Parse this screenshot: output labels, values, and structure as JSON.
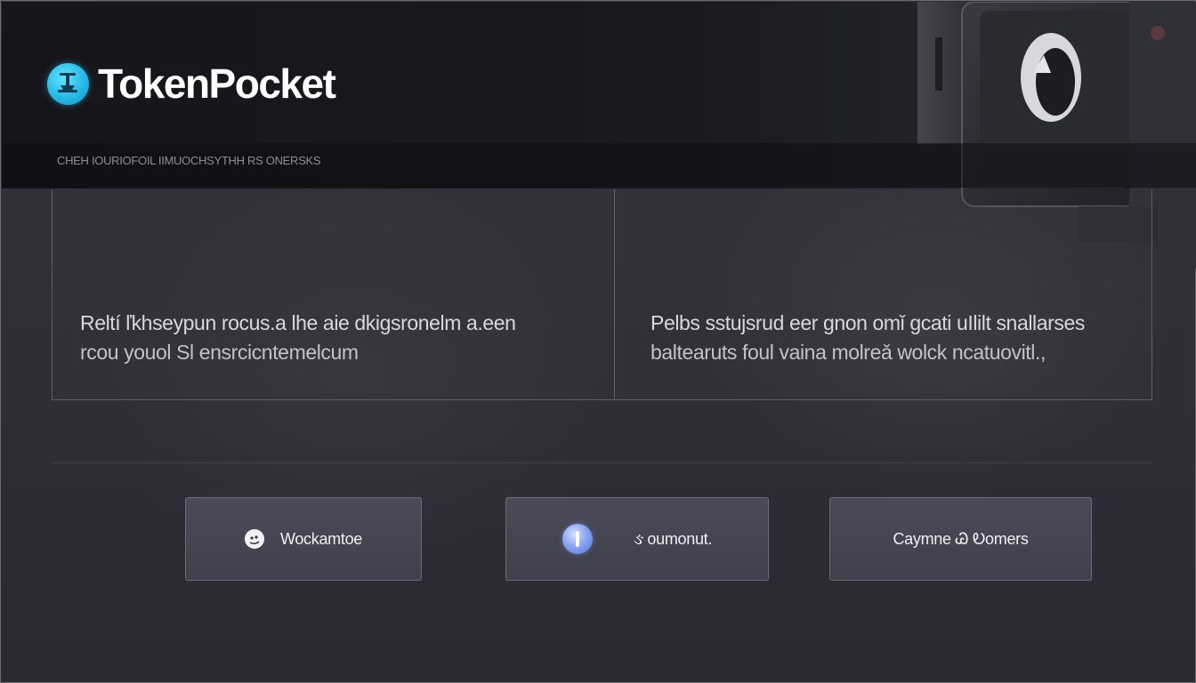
{
  "brand": {
    "name": "TokenPocket",
    "logo_icon": "tokenpocket-logo-icon",
    "accent": "#2fc4ef"
  },
  "header": {
    "tagline": "CHEH IOURIOFOIL IIMUOCHSYTHH RS ONERSKS"
  },
  "info": {
    "left": {
      "line1": "Reltí ľkhseypun rocus.a lhe aie dkigsronelm a.een",
      "line2": "rcou youol Sl ensrcicntemelcum"
    },
    "right": {
      "line1": "Pelbs sstujsrud eer gnon omǐ gcati uIlilt snallarses",
      "line2": "baltearuts foul vaina molreǎ wolck ncatuovitl.,"
    }
  },
  "actions": [
    {
      "label": "Wockamtoe",
      "icon": "chat-bubble-icon"
    },
    {
      "label": "oumonut.",
      "icon": "orb-info-icon",
      "glyph": "ઙ"
    },
    {
      "label": "Caymne Ꮚ Ꭷomers",
      "icon": "none"
    }
  ],
  "colors": {
    "background": "#2e2e37",
    "header": "#17171c",
    "button": "#45454f",
    "border": "#6a6a78"
  }
}
